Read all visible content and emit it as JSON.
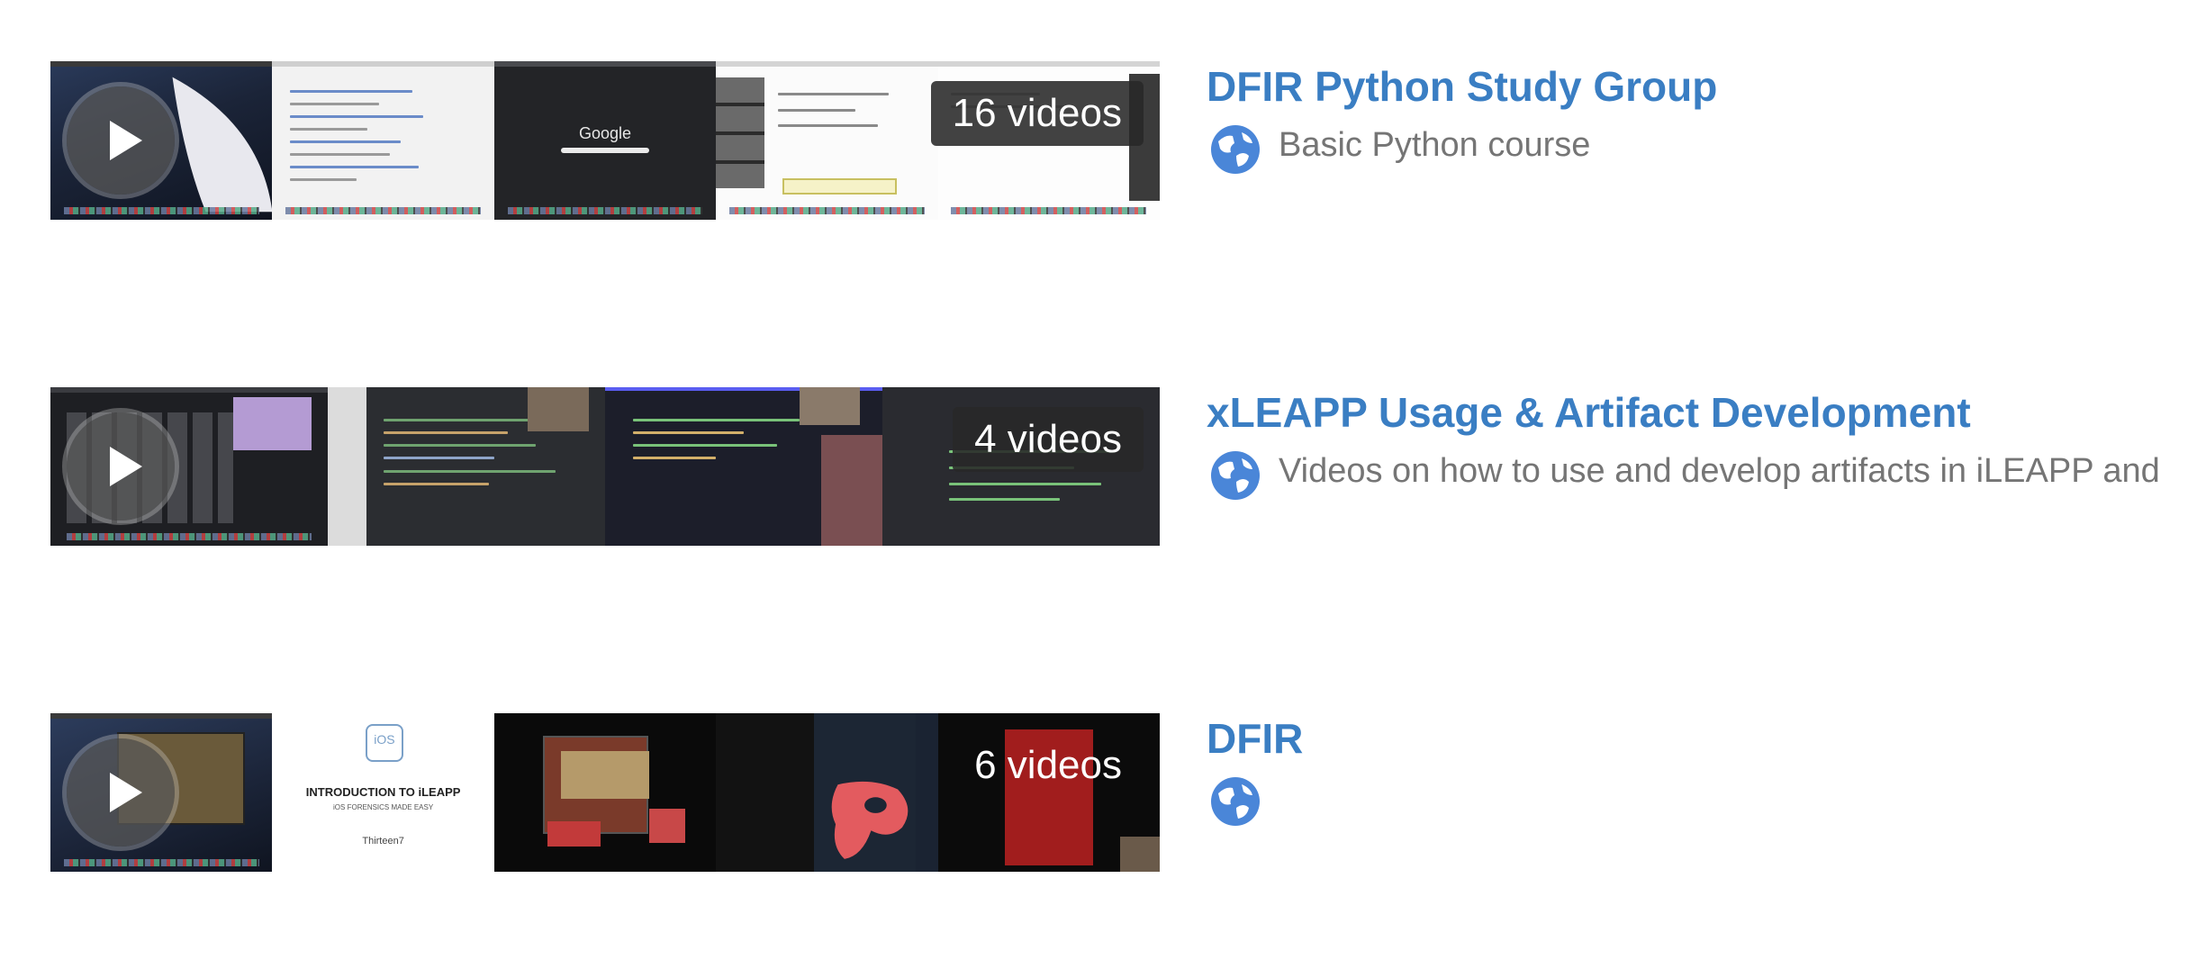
{
  "playlists": [
    {
      "title": "DFIR Python Study Group",
      "video_count": "16 videos",
      "description": "Basic Python course",
      "visibility_icon": "globe-icon"
    },
    {
      "title": "xLEAPP Usage & Artifact Development",
      "video_count": "4 videos",
      "description": "Videos on how to use and develop artifacts in iLEAPP and",
      "visibility_icon": "globe-icon"
    },
    {
      "title": "DFIR",
      "video_count": "6 videos",
      "description": "",
      "visibility_icon": "globe-icon"
    }
  ],
  "thumbnail_text": {
    "google_logo": "Google",
    "ios_label": "iOS",
    "intro_title": "INTRODUCTION TO iLEAPP",
    "intro_subtitle": "iOS FORENSICS MADE EASY",
    "brand": "Thirteen7"
  },
  "colors": {
    "title": "#3a7ec3",
    "description": "#757575",
    "globe": "#4a86d8",
    "badge_bg": "rgba(40,40,40,0.88)"
  }
}
